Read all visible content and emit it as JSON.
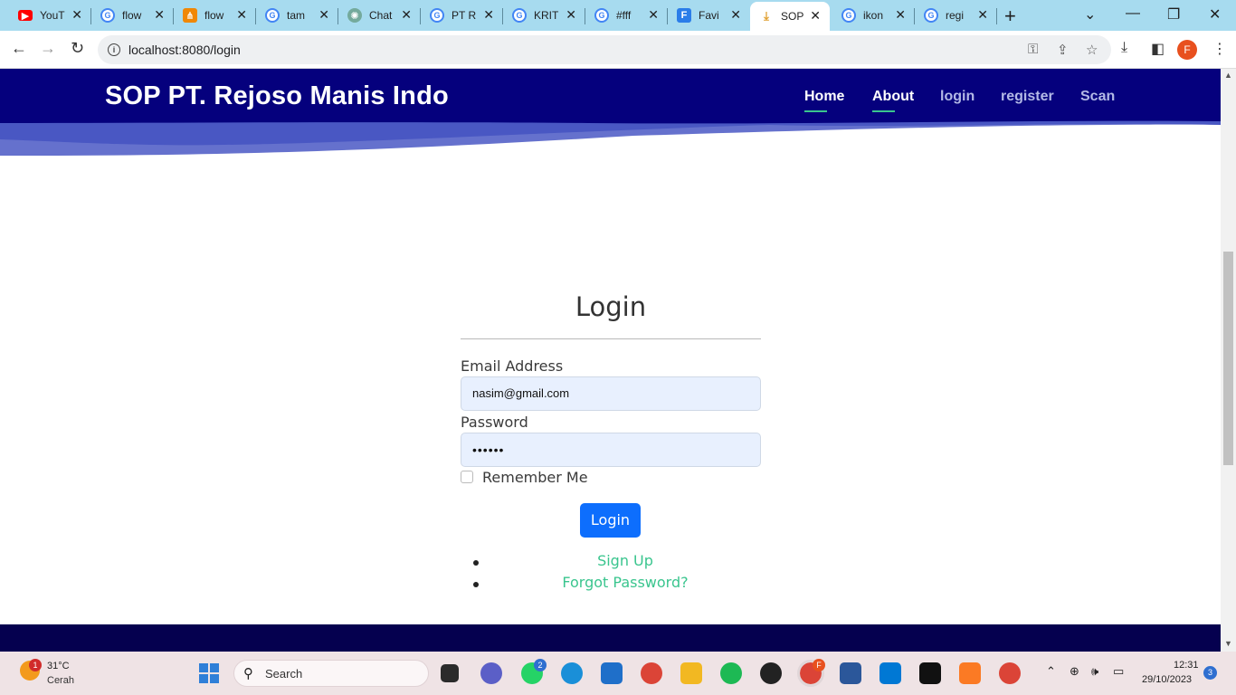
{
  "browser": {
    "tabs": [
      {
        "label": "YouT",
        "icon": "youtube-icon",
        "color": "#ff0000"
      },
      {
        "label": "flow",
        "icon": "google-icon",
        "color": "#4285f4"
      },
      {
        "label": "flow",
        "icon": "drawio-icon",
        "color": "#f08705"
      },
      {
        "label": "tam",
        "icon": "google-icon",
        "color": "#4285f4"
      },
      {
        "label": "Chat",
        "icon": "chatgpt-icon",
        "color": "#74aa9c"
      },
      {
        "label": "PT R",
        "icon": "google-icon",
        "color": "#4285f4"
      },
      {
        "label": "KRIT",
        "icon": "google-icon",
        "color": "#4285f4"
      },
      {
        "label": "#fff",
        "icon": "google-icon",
        "color": "#4285f4"
      },
      {
        "label": "Favi",
        "icon": "favicon-generator-icon",
        "color": "#2b7de9"
      },
      {
        "label": "SOP",
        "icon": "download-spinner-icon",
        "color": "#e0a030",
        "active": true
      },
      {
        "label": "ikon",
        "icon": "google-icon",
        "color": "#4285f4"
      },
      {
        "label": "regi",
        "icon": "google-icon",
        "color": "#4285f4"
      }
    ],
    "url": "localhost:8080/login",
    "profile_initial": "F"
  },
  "site": {
    "title": "SOP PT. Rejoso Manis Indo",
    "nav": [
      {
        "label": "Home",
        "active": true
      },
      {
        "label": "About",
        "active": true
      },
      {
        "label": "login",
        "active": false
      },
      {
        "label": "register",
        "active": false
      },
      {
        "label": "Scan",
        "active": false
      }
    ],
    "colors": {
      "header": "#05007d",
      "accent": "#3ac58e",
      "button": "#0d6efd",
      "footer": "#05004f"
    }
  },
  "login": {
    "title": "Login",
    "email_label": "Email Address",
    "email_value": "nasim@gmail.com",
    "password_label": "Password",
    "password_value": "••••••",
    "remember_label": "Remember Me",
    "remember_checked": false,
    "button_label": "Login",
    "links": [
      "Sign Up",
      "Forgot Password?"
    ]
  },
  "taskbar": {
    "weather_temp": "31°C",
    "weather_condition": "Cerah",
    "weather_badge": "1",
    "search_placeholder": "Search",
    "whatsapp_badge": "2",
    "chrome_badge": "F",
    "time": "12:31",
    "date": "29/10/2023",
    "notification_count": "3"
  }
}
